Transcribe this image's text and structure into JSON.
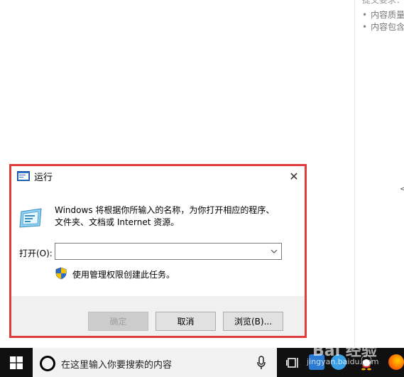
{
  "background_page": {
    "top_text": "提交要求：",
    "list_items": [
      "内容质量",
      "内容包含"
    ]
  },
  "run_dialog": {
    "title": "运行",
    "description_line1": "Windows 将根据你所输入的名称，为你打开相应的程序、",
    "description_line2": "文件夹、文档或 Internet 资源。",
    "open_label": "打开(O):",
    "open_value": "",
    "admin_note": "使用管理权限创建此任务。",
    "buttons": {
      "ok": "确定",
      "cancel": "取消",
      "browse": "浏览(B)..."
    },
    "close_glyph": "✕"
  },
  "taskbar": {
    "search_placeholder": "在这里输入你要搜索的内容",
    "icons": [
      "windows-logo-icon",
      "cortana-icon",
      "microphone-icon",
      "task-view-icon",
      "app-icon",
      "app-icon",
      "qq-icon",
      "firefox-icon"
    ]
  },
  "watermark": {
    "text": "Bai 经验",
    "sub": "jingyan.baidu.com"
  },
  "colors": {
    "highlight_border": "#e03c3c",
    "taskbar": "#101010",
    "footer": "#f0f0f0"
  }
}
